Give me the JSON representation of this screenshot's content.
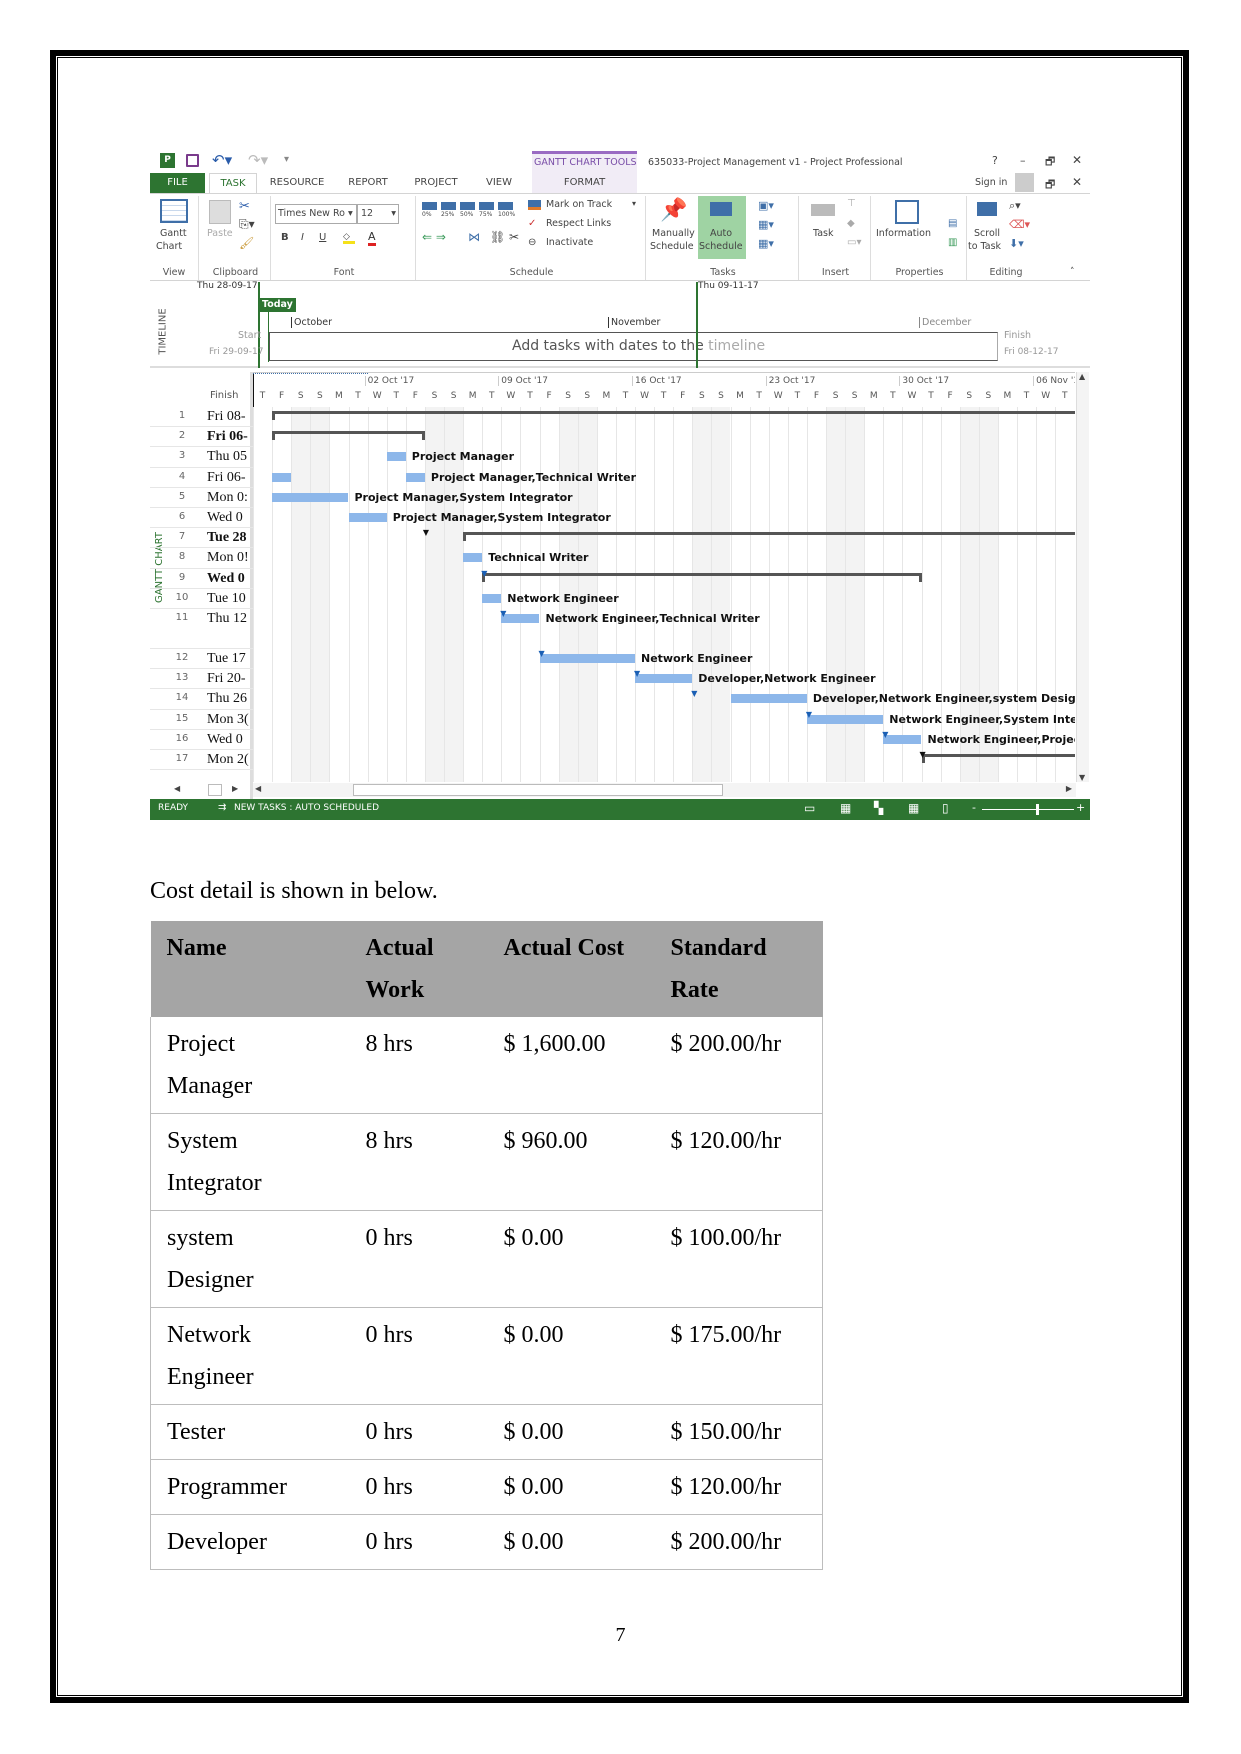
{
  "app": {
    "title": "635033-Project Management v1 - Project Professional",
    "contextual_tab": "GANTT CHART TOOLS",
    "window_controls": {
      "help": "?",
      "minimize": "–",
      "restore": "🗗",
      "close": "✕"
    },
    "sign_in": "Sign in",
    "tabs": [
      {
        "label": "FILE",
        "active": false
      },
      {
        "label": "TASK",
        "active": true
      },
      {
        "label": "RESOURCE",
        "active": false
      },
      {
        "label": "REPORT",
        "active": false
      },
      {
        "label": "PROJECT",
        "active": false
      },
      {
        "label": "VIEW",
        "active": false
      },
      {
        "label": "FORMAT",
        "active": false
      }
    ],
    "ribbon": {
      "view": {
        "label": "View",
        "gantt": "Gantt",
        "chart": "Chart"
      },
      "clipboard": {
        "label": "Clipboard",
        "paste": "Paste"
      },
      "font": {
        "label": "Font",
        "family": "Times New Ro",
        "size": "12",
        "bold": "B",
        "italic": "I",
        "underline": "U",
        "color_a": "A"
      },
      "schedule": {
        "label": "Schedule",
        "percents": [
          "0%",
          "25%",
          "50%",
          "75%",
          "100%"
        ],
        "mark_on_track": "Mark on Track",
        "respect_links": "Respect Links",
        "inactivate": "Inactivate"
      },
      "tasks": {
        "label": "Tasks",
        "manually": "Manually",
        "manually2": "Schedule",
        "auto": "Auto",
        "auto2": "Schedule"
      },
      "insert": {
        "label": "Insert",
        "task": "Task"
      },
      "properties": {
        "label": "Properties",
        "information": "Information"
      },
      "editing": {
        "label": "Editing",
        "scroll": "Scroll",
        "scroll2": "to Task"
      }
    },
    "timeline": {
      "side_label": "TIMELINE",
      "today_date": "Thu 28-09-17",
      "today": "Today",
      "marker_date": "Thu 09-11-17",
      "months": [
        "October",
        "November",
        "December"
      ],
      "start_label": "Start",
      "start_date": "Fri 29-09-17",
      "finish_label": "Finish",
      "finish_date": "Fri 08-12-17",
      "placeholder_a": "Add tasks with dates to the",
      "placeholder_b": "timeline"
    },
    "gantt": {
      "side_label": "GANTT CHART",
      "finish_header": "Finish",
      "weeks": [
        "02 Oct '17",
        "09 Oct '17",
        "16 Oct '17",
        "23 Oct '17",
        "30 Oct '17",
        "06 Nov '17"
      ],
      "day_letters": [
        "T",
        "F",
        "S",
        "S",
        "M",
        "T",
        "W",
        "T",
        "F",
        "S",
        "S",
        "M",
        "T",
        "W",
        "T",
        "F",
        "S",
        "S",
        "M",
        "T",
        "W",
        "T",
        "F",
        "S",
        "S",
        "M",
        "T",
        "W",
        "T",
        "F",
        "S",
        "S",
        "M",
        "T",
        "W",
        "T",
        "F",
        "S",
        "S",
        "M",
        "T",
        "W",
        "T"
      ],
      "colors": {
        "bar": "#8db7ea",
        "summary": "#555555",
        "link": "#1a5fb4",
        "today": "#2d7431"
      },
      "rows": [
        {
          "id": "1",
          "finish": "Fri 08-",
          "bold": false,
          "type": "summary",
          "start": "2017-09-27"
        },
        {
          "id": "2",
          "finish": "Fri 06-",
          "bold": true,
          "type": "summary",
          "start": "2017-09-27",
          "end": "2017-10-05"
        },
        {
          "id": "3",
          "finish": "Thu 05",
          "bold": false,
          "type": "task",
          "start": "2017-10-03",
          "end": "2017-10-04",
          "label": "Project Manager"
        },
        {
          "id": "4",
          "finish": "Fri 06-",
          "bold": false,
          "type": "split",
          "segments": [
            [
              "2017-09-27",
              "2017-09-28"
            ],
            [
              "2017-10-04",
              "2017-10-05"
            ]
          ],
          "label": "Project Manager,Technical Writer"
        },
        {
          "id": "5",
          "finish": "Mon 0:",
          "bold": false,
          "type": "task",
          "start": "2017-09-27",
          "end": "2017-10-01",
          "label": "Project Manager,System Integrator"
        },
        {
          "id": "6",
          "finish": "Wed 0",
          "bold": false,
          "type": "task",
          "start": "2017-10-01",
          "end": "2017-10-03",
          "label": "Project Manager,System Integrator"
        },
        {
          "id": "7",
          "finish": "Tue 28",
          "bold": true,
          "type": "summary",
          "start": "2017-10-07"
        },
        {
          "id": "8",
          "finish": "Mon 0!",
          "bold": false,
          "type": "task",
          "start": "2017-10-07",
          "end": "2017-10-08",
          "label": "Technical Writer"
        },
        {
          "id": "9",
          "finish": "Wed 0",
          "bold": true,
          "type": "summary",
          "start": "2017-10-08",
          "end": "2017-10-31"
        },
        {
          "id": "10",
          "finish": "Tue 10",
          "bold": false,
          "type": "task",
          "start": "2017-10-08",
          "end": "2017-10-09",
          "label": "Network Engineer"
        },
        {
          "id": "11",
          "finish": "Thu 12",
          "bold": false,
          "type": "task",
          "start": "2017-10-09",
          "end": "2017-10-11",
          "label": "Network Engineer,Technical Writer"
        },
        {
          "id": "12",
          "finish": "Tue 17",
          "bold": false,
          "type": "task",
          "start": "2017-10-11",
          "end": "2017-10-16",
          "label": "Network Engineer"
        },
        {
          "id": "13",
          "finish": "Fri 20-",
          "bold": false,
          "type": "task",
          "start": "2017-10-16",
          "end": "2017-10-19",
          "label": "Developer,Network Engineer"
        },
        {
          "id": "14",
          "finish": "Thu 26",
          "bold": false,
          "type": "task",
          "start": "2017-10-21",
          "end": "2017-10-25",
          "label": "Developer,Network Engineer,system Designer"
        },
        {
          "id": "15",
          "finish": "Mon 3(",
          "bold": false,
          "type": "task",
          "start": "2017-10-25",
          "end": "2017-10-29",
          "label": "Network Engineer,System Integr"
        },
        {
          "id": "16",
          "finish": "Wed 0",
          "bold": false,
          "type": "task",
          "start": "2017-10-29",
          "end": "2017-10-31",
          "label": "Network Engineer,Project"
        },
        {
          "id": "17",
          "finish": "Mon 2(",
          "bold": false,
          "type": "summary",
          "start": "2017-10-31"
        }
      ],
      "links": [
        [
          2,
          7,
          "black"
        ],
        [
          8,
          9,
          "blue"
        ],
        [
          10,
          11,
          "blue"
        ],
        [
          11,
          12,
          "blue"
        ],
        [
          12,
          13,
          "blue"
        ],
        [
          13,
          14,
          "blue"
        ],
        [
          14,
          15,
          "blue"
        ],
        [
          15,
          16,
          "blue"
        ],
        [
          9,
          17,
          "black"
        ]
      ]
    },
    "status": {
      "ready": "READY",
      "new_tasks": "NEW TASKS : AUTO SCHEDULED"
    }
  },
  "document": {
    "intro": "Cost detail is shown in below.",
    "table": {
      "headers": [
        "Name",
        "Actual Work",
        "Actual Cost",
        "Standard Rate"
      ],
      "rows": [
        [
          "Project Manager",
          "8 hrs",
          "$ 1,600.00",
          "$ 200.00/hr"
        ],
        [
          "System Integrator",
          "8 hrs",
          "$ 960.00",
          "$ 120.00/hr"
        ],
        [
          "system Designer",
          "0 hrs",
          "$ 0.00",
          "$ 100.00/hr"
        ],
        [
          "Network Engineer",
          "0 hrs",
          "$ 0.00",
          "$ 175.00/hr"
        ],
        [
          "Tester",
          "0 hrs",
          "$ 0.00",
          "$ 150.00/hr"
        ],
        [
          "Programmer",
          "0 hrs",
          "$ 0.00",
          "$ 120.00/hr"
        ],
        [
          "Developer",
          "0 hrs",
          "$ 0.00",
          "$ 200.00/hr"
        ]
      ]
    },
    "page_number": "7"
  }
}
